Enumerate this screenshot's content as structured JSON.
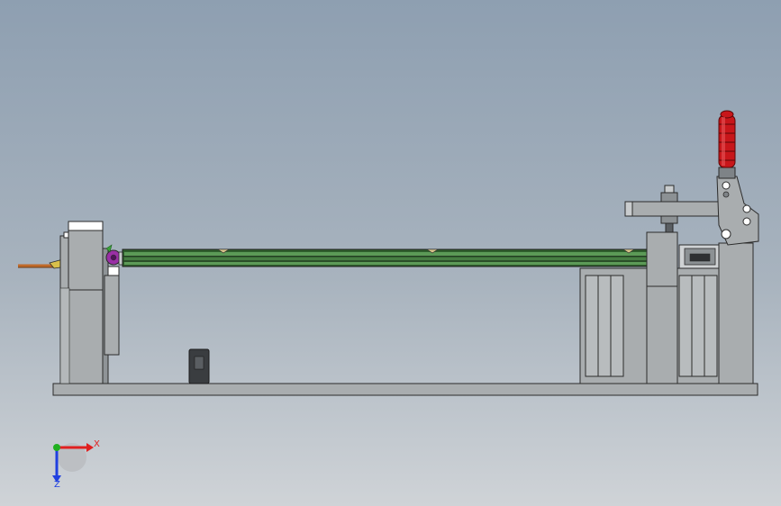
{
  "viewport": {
    "background_top": "#8e9fb1",
    "background_bottom": "#cfd3d7"
  },
  "model": {
    "description_icon": "cad-assembly-side-view",
    "colors": {
      "metal": "#a9adaf",
      "metal_dark": "#7e8387",
      "outline": "#2b2b2b",
      "rod": "#3d6f3a",
      "handle": "#c8161a",
      "accent_purple": "#9a2fa6",
      "wire_orange": "#c06a2a"
    }
  },
  "triad": {
    "x_label": "X",
    "z_label": "Z",
    "x_color": "#e02020",
    "y_color": "#20b020",
    "z_color": "#2040e0"
  }
}
